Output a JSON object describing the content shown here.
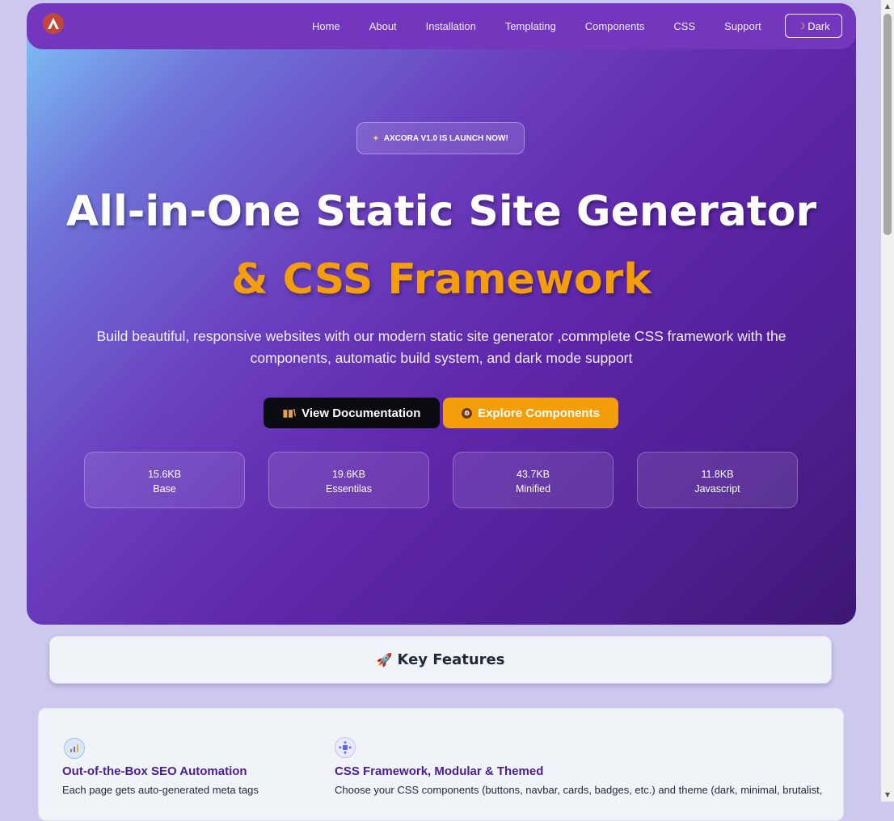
{
  "nav": {
    "items": [
      "Home",
      "About",
      "Installation",
      "Templating",
      "Components",
      "CSS",
      "Support"
    ],
    "theme_toggle": {
      "icon": "moon-icon",
      "label": "Dark"
    }
  },
  "hero": {
    "badge": {
      "icon": "sparkle-icon",
      "text": "AXCORA V1.0 IS LAUNCH NOW!"
    },
    "title": "All-in-One Static Site Generator",
    "title_accent": "& CSS Framework",
    "subtitle": "Build beautiful, responsive websites with our modern static site generator ,commplete CSS framework with the components, automatic build system, and dark mode support",
    "buttons": [
      {
        "icon": "books-icon",
        "label": "View Documentation"
      },
      {
        "icon": "gear-icon",
        "label": "Explore Components"
      }
    ],
    "stats": [
      {
        "value": "15.6KB",
        "label": "Base"
      },
      {
        "value": "19.6KB",
        "label": "Essentilas"
      },
      {
        "value": "43.7KB",
        "label": "Minified"
      },
      {
        "value": "11.8KB",
        "label": "Javascript"
      }
    ]
  },
  "key_features": {
    "icon": "rocket-icon",
    "title": "Key Features"
  },
  "features": [
    {
      "icon": "seo-chart-icon",
      "title": "Out-of-the-Box SEO Automation",
      "description": "Each page gets auto-generated meta tags"
    },
    {
      "icon": "modules-icon",
      "title": "CSS Framework, Modular & Themed",
      "description": "Choose your CSS components (buttons, navbar, cards, badges, etc.) and theme (dark, minimal, brutalist,"
    }
  ],
  "colors": {
    "accent": "#f59e0b",
    "hero_purple": "#5f27aa",
    "nav_purple": "#7536be",
    "feature_title": "#4c1d95",
    "page_bg": "#cdc9ee"
  }
}
